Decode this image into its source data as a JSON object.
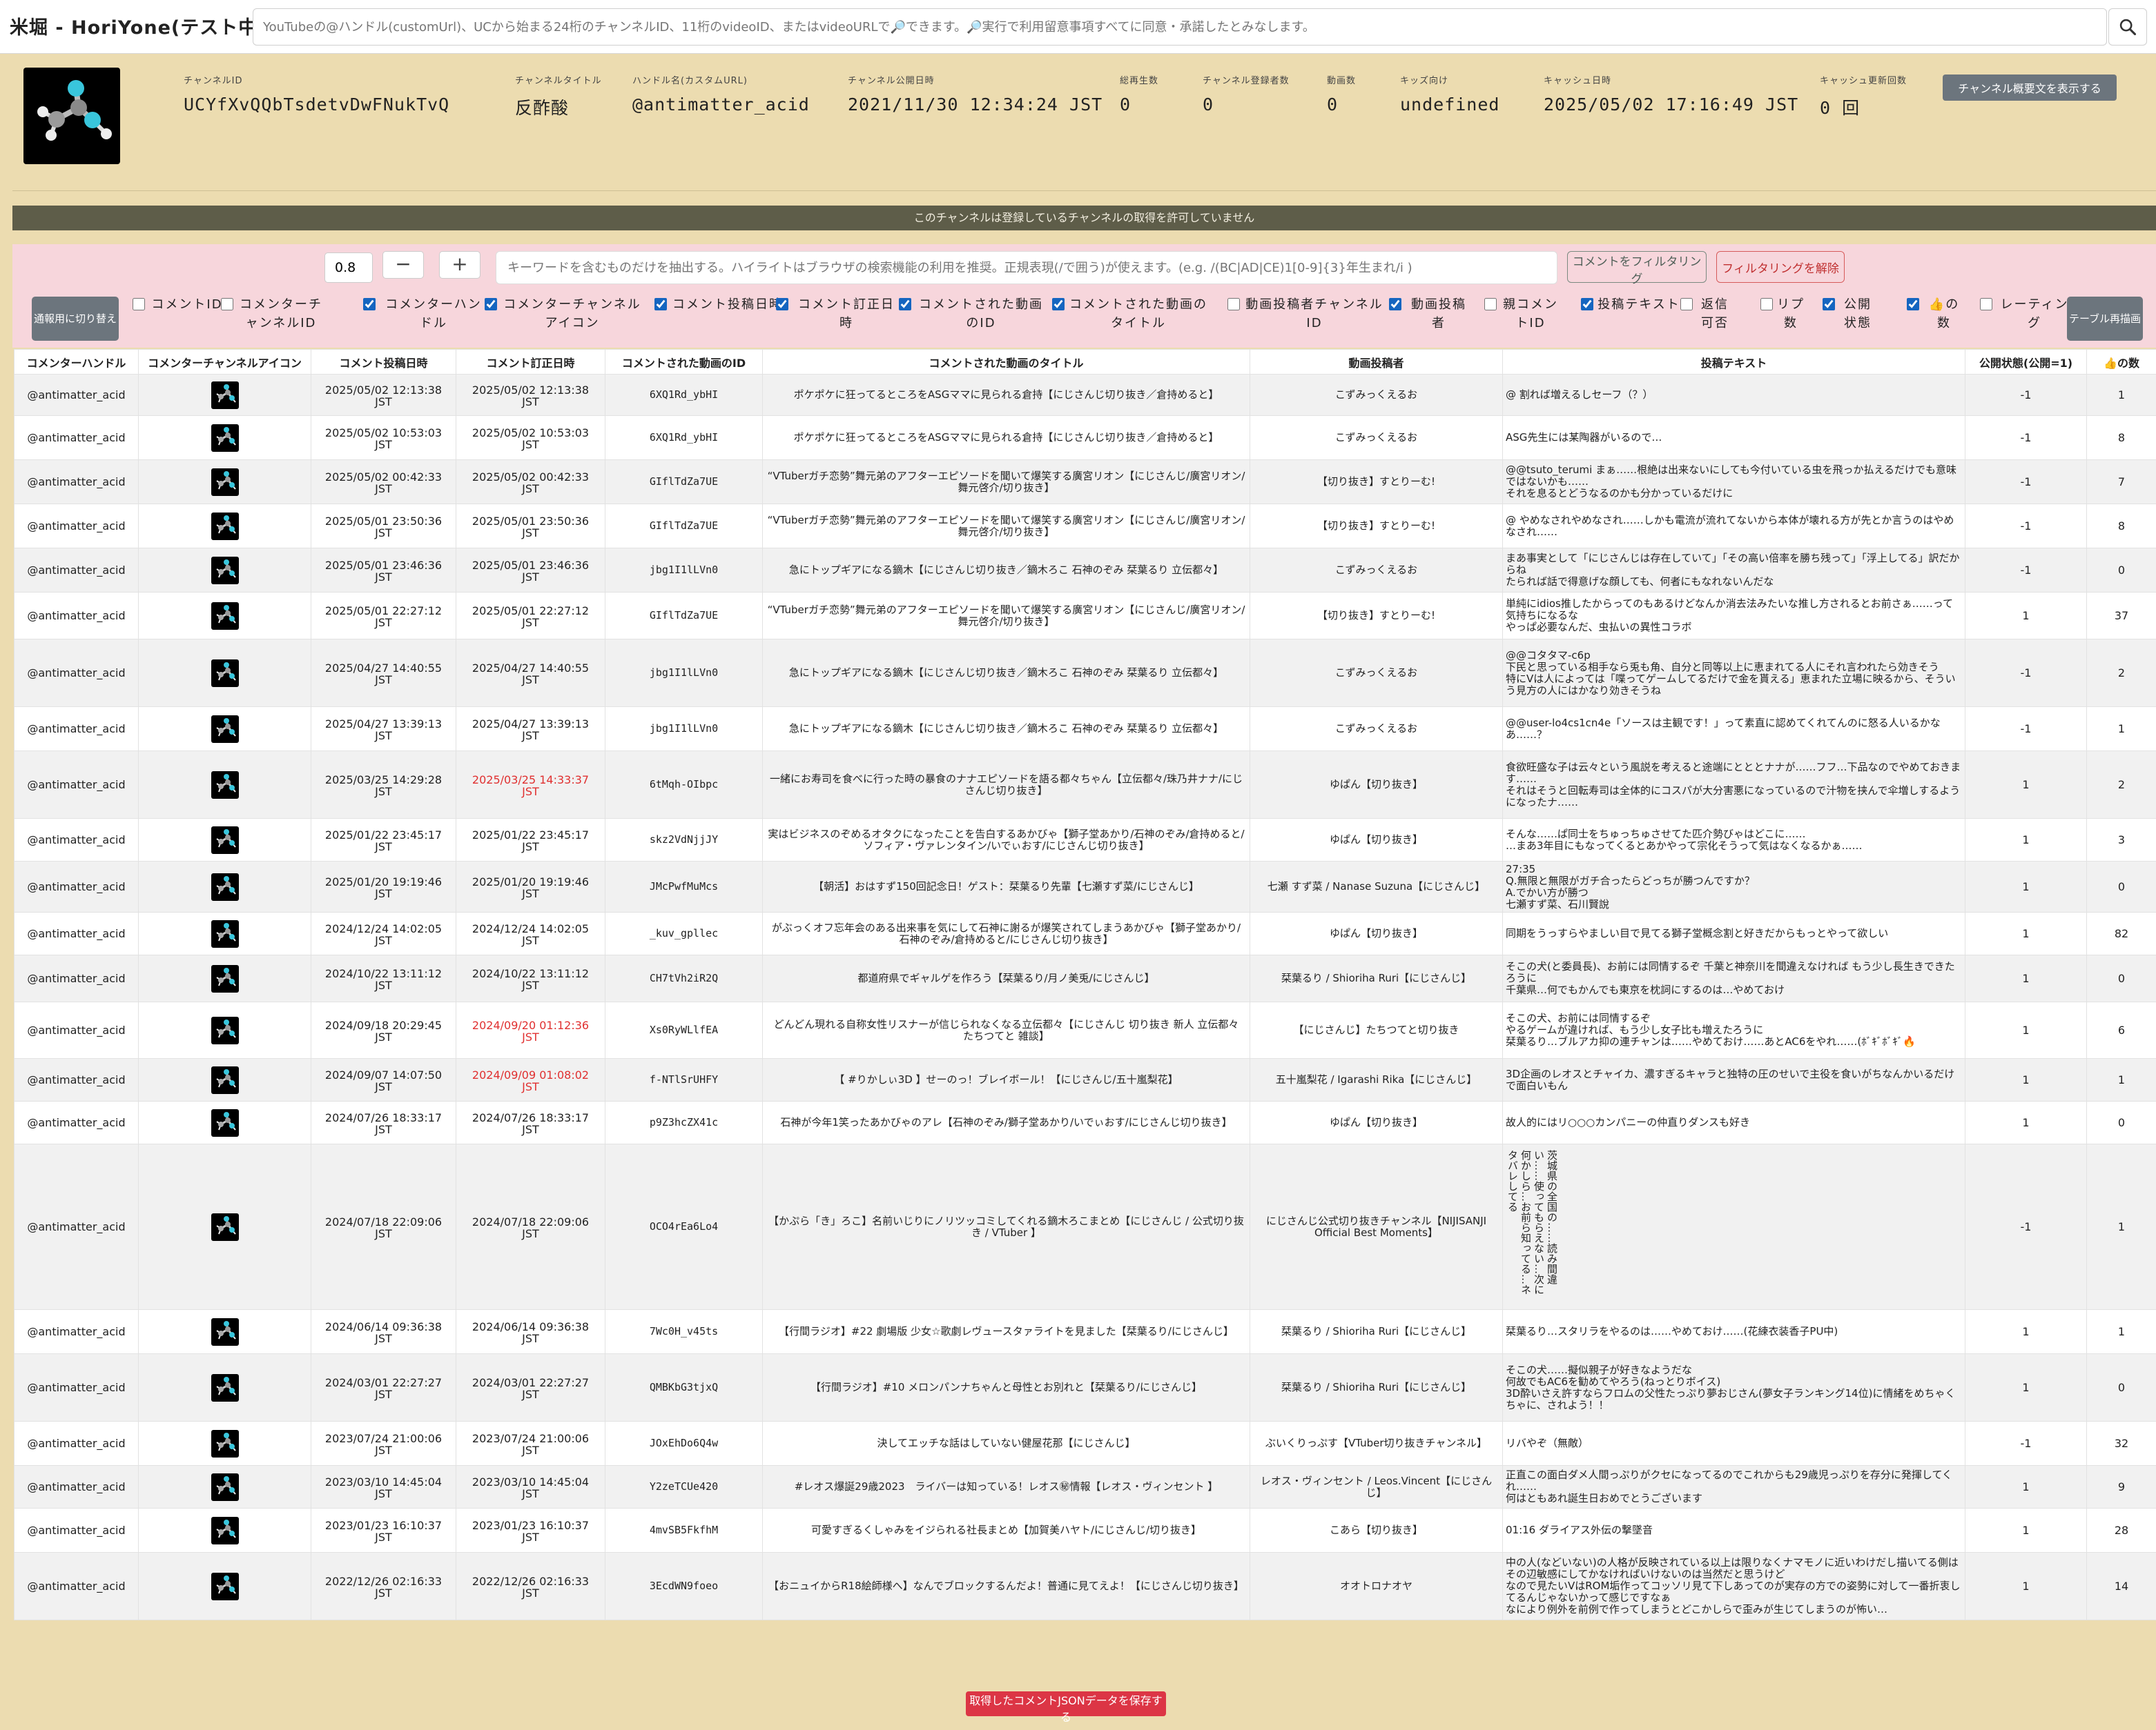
{
  "app_title": "米堀 - HoriYone(テスト中)",
  "search": {
    "placeholder": "YouTubeの@ハンドル(customUrl)、UCから始まる24桁のチャンネルID、11桁のvideoID、またはvideoURLで🔎できます。🔎実行で利用留意事項すべてに同意・承諾したとみなします。"
  },
  "channel": {
    "id_label": "チャンネルID",
    "id": "UCYfXvQQbTsdetvDwFNukTvQ",
    "title_label": "チャンネルタイトル",
    "title": "反酢酸",
    "handle_label": "ハンドル名(カスタムURL)",
    "handle": "@antimatter_acid",
    "published_label": "チャンネル公開日時",
    "published": "2021/11/30 12:34:24 JST",
    "views_label": "総再生数",
    "views": "0",
    "subs_label": "チャンネル登録者数",
    "subs": "0",
    "videos_label": "動画数",
    "videos": "0",
    "kids_label": "キッズ向け",
    "kids": "undefined",
    "cache_label": "キャッシュ日時",
    "cache": "2025/05/02 17:16:49 JST",
    "cache_count_label": "キャッシュ更新回数",
    "cache_count": "0 回",
    "summary_button": "チャンネル概要文を表示する"
  },
  "banner": "このチャンネルは登録しているチャンネルの取得を許可していません",
  "filter": {
    "threshold": "0.8",
    "minus": "−",
    "plus": "+",
    "keyword_placeholder": "キーワードを含むものだけを抽出する。ハイライトはブラウザの検索機能の利用を推奨。正規表現(/で囲う)が使えます。(e.g. /(BC|AD|CE)1[0-9]{3}年生まれ/i )",
    "apply_label": "コメントをフィルタリング",
    "clear_label": "フィルタリングを解除",
    "toggle_label": "通報用に切り替え",
    "redraw_label": "テーブル再描画"
  },
  "columns": [
    {
      "label": "コメントID",
      "checked": false
    },
    {
      "label": "コメンターチャンネルID",
      "checked": false
    },
    {
      "label": "コメンターハンドル",
      "checked": true
    },
    {
      "label": "コメンターチャンネルアイコン",
      "checked": true
    },
    {
      "label": "コメント投稿日時",
      "checked": true
    },
    {
      "label": "コメント訂正日時",
      "checked": true
    },
    {
      "label": "コメントされた動画のID",
      "checked": true
    },
    {
      "label": "コメントされた動画のタイトル",
      "checked": true
    },
    {
      "label": "動画投稿者チャンネルID",
      "checked": false
    },
    {
      "label": "動画投稿者",
      "checked": true
    },
    {
      "label": "親コメントID",
      "checked": false
    },
    {
      "label": "投稿テキスト",
      "checked": true
    },
    {
      "label": "返信可否",
      "checked": false
    },
    {
      "label": "リプ数",
      "checked": false
    },
    {
      "label": "公開状態",
      "checked": true
    },
    {
      "label": "👍の数",
      "checked": true
    },
    {
      "label": "レーティング",
      "checked": false
    }
  ],
  "table": {
    "headers": [
      "コメンターハンドル",
      "コメンターチャンネルアイコン",
      "コメント投稿日時",
      "コメント訂正日時",
      "コメントされた動画のID",
      "コメントされた動画のタイトル",
      "動画投稿者",
      "投稿テキスト",
      "公開状態(公開=1)",
      "👍の数"
    ],
    "rows": [
      {
        "handle": "@antimatter_acid",
        "posted": "2025/05/02 12:13:38\nJST",
        "edited": "2025/05/02 12:13:38\nJST",
        "edited_red": false,
        "video_id": "6XQ1Rd_ybHI",
        "title": "ポケポケに狂ってるところをASGママに見られる倉持【にじさんじ切り抜き／倉持めると】",
        "uploader": "こずみっくえるお",
        "text": "@ 割れば増えるしセーフ（？）",
        "status": "-1",
        "likes": "1"
      },
      {
        "handle": "@antimatter_acid",
        "posted": "2025/05/02 10:53:03\nJST",
        "edited": "2025/05/02 10:53:03\nJST",
        "edited_red": false,
        "video_id": "6XQ1Rd_ybHI",
        "title": "ポケポケに狂ってるところをASGママに見られる倉持【にじさんじ切り抜き／倉持めると】",
        "uploader": "こずみっくえるお",
        "text": "ASG先生には某陶器がいるので…",
        "status": "-1",
        "likes": "8"
      },
      {
        "handle": "@antimatter_acid",
        "posted": "2025/05/02 00:42:33\nJST",
        "edited": "2025/05/02 00:42:33\nJST",
        "edited_red": false,
        "video_id": "GIflTdZa7UE",
        "title": "“VTuberガチ恋勢”舞元弟のアフターエピソードを聞いて爆笑する廣宮リオン【にじさんじ/廣宮リオン/舞元啓介/切り抜き】",
        "uploader": "【切り抜き】すとりーむ!",
        "text": "@@tsuto_terumi まぁ……根絶は出来ないにしても今付いている虫を飛っか払えるだけでも意味ではないかも……\nそれを息るとどうなるのかも分かっているだけに",
        "status": "-1",
        "likes": "7"
      },
      {
        "handle": "@antimatter_acid",
        "posted": "2025/05/01 23:50:36\nJST",
        "edited": "2025/05/01 23:50:36\nJST",
        "edited_red": false,
        "video_id": "GIflTdZa7UE",
        "title": "“VTuberガチ恋勢”舞元弟のアフターエピソードを聞いて爆笑する廣宮リオン【にじさんじ/廣宮リオン/舞元啓介/切り抜き】",
        "uploader": "【切り抜き】すとりーむ!",
        "text": "@ やめなされやめなされ……しかも電流が流れてないから本体が壊れる方が先とか言うのはやめなされ……",
        "status": "-1",
        "likes": "8"
      },
      {
        "handle": "@antimatter_acid",
        "posted": "2025/05/01 23:46:36\nJST",
        "edited": "2025/05/01 23:46:36\nJST",
        "edited_red": false,
        "video_id": "jbg1I1lLVn0",
        "title": "急にトップギアになる鏑木【にじさんじ切り抜き／鏑木ろこ 石神のぞみ 栞葉るり 立伝都々】",
        "uploader": "こずみっくえるお",
        "text": "まあ事実として「にじさんじは存在していて」「その高い倍率を勝ち残って」「浮上してる」訳だからね\nたられば話で得意げな顔しても、何者にもなれないんだな",
        "status": "-1",
        "likes": "0"
      },
      {
        "handle": "@antimatter_acid",
        "posted": "2025/05/01 22:27:12\nJST",
        "edited": "2025/05/01 22:27:12\nJST",
        "edited_red": false,
        "video_id": "GIflTdZa7UE",
        "title": "“VTuberガチ恋勢”舞元弟のアフターエピソードを聞いて爆笑する廣宮リオン【にじさんじ/廣宮リオン/舞元啓介/切り抜き】",
        "uploader": "【切り抜き】すとりーむ!",
        "text": "単純にidios推したからってのもあるけどなんか消去法みたいな推し方されるとお前さぁ……って気持ちになるな\nやっぱ必要なんだ、虫払いの異性コラボ",
        "status": "1",
        "likes": "37"
      },
      {
        "handle": "@antimatter_acid",
        "posted": "2025/04/27 14:40:55\nJST",
        "edited": "2025/04/27 14:40:55\nJST",
        "edited_red": false,
        "video_id": "jbg1I1lLVn0",
        "title": "急にトップギアになる鏑木【にじさんじ切り抜き／鏑木ろこ 石神のぞみ 栞葉るり 立伝都々】",
        "uploader": "こずみっくえるお",
        "text": "@@コタタマ-c6p\n下民と思っている相手なら兎も角、自分と同等以上に恵まれてる人にそれ言われたら効きそう\n特にVは人によっては「喋ってゲームしてるだけで金を貰える」恵まれた立場に映るから、そういう見方の人にはかなり効きそうね",
        "status": "-1",
        "likes": "2"
      },
      {
        "handle": "@antimatter_acid",
        "posted": "2025/04/27 13:39:13\nJST",
        "edited": "2025/04/27 13:39:13\nJST",
        "edited_red": false,
        "video_id": "jbg1I1lLVn0",
        "title": "急にトップギアになる鏑木【にじさんじ切り抜き／鏑木ろこ 石神のぞみ 栞葉るり 立伝都々】",
        "uploader": "こずみっくえるお",
        "text": "@@user-lo4cs1cn4e「ソースは主観です！」って素直に認めてくれてんのに怒る人いるかなあ……？",
        "status": "-1",
        "likes": "1"
      },
      {
        "handle": "@antimatter_acid",
        "posted": "2025/03/25 14:29:28\nJST",
        "edited": "2025/03/25 14:33:37\nJST",
        "edited_red": true,
        "video_id": "6tMqh-OIbpc",
        "title": "一緒にお寿司を食べに行った時の暴食のナナエピソードを語る都々ちゃん【立伝都々/珠乃井ナナ/にじさんじ切り抜き】",
        "uploader": "ゆぱん【切り抜き】",
        "text": "食欲旺盛な子は云々という風説を考えると途端にとととナナが……フフ…下品なのでやめておきます……\nそれはそうと回転寿司は全体的にコスパが大分害悪になっているので汁物を挟んで伞増しするようになったナ……",
        "status": "1",
        "likes": "2"
      },
      {
        "handle": "@antimatter_acid",
        "posted": "2025/01/22 23:45:17\nJST",
        "edited": "2025/01/22 23:45:17\nJST",
        "edited_red": false,
        "video_id": "skz2VdNjjJY",
        "title": "実はビジネスのぞめるオタクになったことを告白するあかびゃ【獅子堂あかり/石神のぞみ/倉持めると/ソフィア・ヴァレンタイン/いでぃおす/にじさんじ切り抜き】",
        "uploader": "ゆぱん【切り抜き】",
        "text": "そんな……ぱ同士をちゅっちゅさせてた匹介勢びゃはどこに……\n…まあ3年目にもなってくるとあかやって宗化そうって気はなくなるかぁ……",
        "status": "1",
        "likes": "3"
      },
      {
        "handle": "@antimatter_acid",
        "posted": "2025/01/20 19:19:46\nJST",
        "edited": "2025/01/20 19:19:46\nJST",
        "edited_red": false,
        "video_id": "JMcPwfMuMcs",
        "title": "【朝活】おはすず150回記念日！ゲスト：栞葉るり先輩【七瀬すず菜/にじさんじ】",
        "uploader": "七瀬 すず菜 / Nanase Suzuna【にじさんじ】",
        "text": "27:35\nQ.無限と無限がガチ合ったらどっちが勝つんですか？\nA.でかい方が勝つ\n七瀬すず菜、石川賢說",
        "status": "1",
        "likes": "0"
      },
      {
        "handle": "@antimatter_acid",
        "posted": "2024/12/24 14:02:05\nJST",
        "edited": "2024/12/24 14:02:05\nJST",
        "edited_red": false,
        "video_id": "_kuv_gpllec",
        "title": "がぶっくオフ忘年会のある出来事を気にして石神に謝るが爆笑されてしまうあかびゃ【獅子堂あかり/石神のぞみ/倉持めると/にじさんじ切り抜き】",
        "uploader": "ゆぱん【切り抜き】",
        "text": "同期をうっすらやましい目で見てる獅子堂概念割と好きだからもっとやって欲しい",
        "status": "1",
        "likes": "82"
      },
      {
        "handle": "@antimatter_acid",
        "posted": "2024/10/22 13:11:12\nJST",
        "edited": "2024/10/22 13:11:12\nJST",
        "edited_red": false,
        "video_id": "CH7tVh2iR2Q",
        "title": "都道府県でギャルゲを作ろう【栞葉るり/月ノ美兎/にじさんじ】",
        "uploader": "栞葉るり / Shioriha Ruri【にじさんじ】",
        "text": "そこの犬(と委員長)、お前には同情するぞ 千葉と神奈川を間違えなければ もう少し長生きできたろうに\n千葉県…何でもかんでも東京を枕詞にするのは…やめておけ",
        "status": "1",
        "likes": "0"
      },
      {
        "handle": "@antimatter_acid",
        "posted": "2024/09/18 20:29:45\nJST",
        "edited": "2024/09/20 01:12:36\nJST",
        "edited_red": true,
        "video_id": "Xs0RyWLlfEA",
        "title": "どんどん現れる自称女性リスナーが信じられなくなる立伝都々【にじさんじ 切り抜き 新人 立伝都々 たちつてと 雑談】",
        "uploader": "【にじさんじ】たちつてと切り抜き",
        "text": "そこの犬、お前には同情するぞ\nやるゲームが違ければ、もう少し女子比も増えたろうに\n栞葉るり…ブルアカ抑の連チャンは……やめておけ……あとAC6をやれ……(ﾎﾞｷﾞﾎﾞｷﾞ🔥",
        "status": "1",
        "likes": "6"
      },
      {
        "handle": "@antimatter_acid",
        "posted": "2024/09/07 14:07:50\nJST",
        "edited": "2024/09/09 01:08:02\nJST",
        "edited_red": true,
        "video_id": "f-NTlSrUHFY",
        "title": "【 #りかしぃ3D 】せーのっ！ブレイボール！【にじさんじ/五十嵐梨花】",
        "uploader": "五十嵐梨花 / Igarashi Rika【にじさんじ】",
        "text": "3D企画のレオスとチャイカ、濃すぎるキャラと独特の圧のせいで主役を食いがちなんかいるだけで面白いもん",
        "status": "1",
        "likes": "1"
      },
      {
        "handle": "@antimatter_acid",
        "posted": "2024/07/26 18:33:17\nJST",
        "edited": "2024/07/26 18:33:17\nJST",
        "edited_red": false,
        "video_id": "p9Z3hcZX41c",
        "title": "石神が今年1笑ったあかびゃのアレ【石神のぞみ/獅子堂あかり/いでぃおす/にじさんじ切り抜き】",
        "uploader": "ゆぱん【切り抜き】",
        "text": "故人的にはリ○○○カンパニーの仲直りダンスも好き",
        "status": "1",
        "likes": "0"
      },
      {
        "handle": "@antimatter_acid",
        "posted": "2024/07/18 22:09:06\nJST",
        "edited": "2024/07/18 22:09:06\nJST",
        "edited_red": false,
        "video_id": "OCO4rEa6Lo4",
        "title": "【かぷら「き」ろこ】名前いじりにノリツッコミしてくれる鏑木ろこまとめ【にじさんじ / 公式切り抜き / VTuber 】",
        "uploader": "にじさんじ公式切り抜きチャンネル【NIJISANJI Official Best Moments】",
        "text": "茨城県の全国の……読み間違い……使ってもらえない…次に何かしら…お前ら知ってる…ネタバレしてる",
        "status": "-1",
        "likes": "1"
      },
      {
        "handle": "@antimatter_acid",
        "posted": "2024/06/14 09:36:38\nJST",
        "edited": "2024/06/14 09:36:38\nJST",
        "edited_red": false,
        "video_id": "7Wc0H_v45ts",
        "title": "【行間ラジオ】#22 劇場版 少女☆歌劇レヴュースタァライトを見ました【栞葉るり/にじさんじ】",
        "uploader": "栞葉るり / Shioriha Ruri【にじさんじ】",
        "text": "栞葉るり…スタリラをやるのは……やめておけ……(花練衣装香子PU中)",
        "status": "1",
        "likes": "1"
      },
      {
        "handle": "@antimatter_acid",
        "posted": "2024/03/01 22:27:27\nJST",
        "edited": "2024/03/01 22:27:27\nJST",
        "edited_red": false,
        "video_id": "QMBKbG3tjxQ",
        "title": "【行間ラジオ】#10 メロンパンナちゃんと母性とお別れと【栞葉るり/にじさんじ】",
        "uploader": "栞葉るり / Shioriha Ruri【にじさんじ】",
        "text": "そこの犬……擬似親子が好きなようだな\n何故でもAC6を勧めてやろう(ねっとりボイス)\n3D酔いさえ許すならフロムの父性たっぷり夢おじさん(夢女子ランキング14位)に情緒をめちゃくちゃに、されよう！！",
        "status": "1",
        "likes": "0"
      },
      {
        "handle": "@antimatter_acid",
        "posted": "2023/07/24 21:00:06\nJST",
        "edited": "2023/07/24 21:00:06\nJST",
        "edited_red": false,
        "video_id": "JOxEhDo6Q4w",
        "title": "決してエッチな話はしていない健屋花那【にじさんじ】",
        "uploader": "ぶいくりっぷす【VTuber切り抜きチャンネル】",
        "text": "リバやぞ（無敵）",
        "status": "-1",
        "likes": "32"
      },
      {
        "handle": "@antimatter_acid",
        "posted": "2023/03/10 14:45:04\nJST",
        "edited": "2023/03/10 14:45:04\nJST",
        "edited_red": false,
        "video_id": "Y2zeTCUe420",
        "title": "#レオス爆誕29歳2023　ライバーは知っている！レオス㊙情報【レオス・ヴィンセント 】",
        "uploader": "レオス・ヴィンセント / Leos.Vincent【にじさんじ】",
        "text": "正直この面白ダメ人間っぷりがクセになってるのでこれからも29歳児っぷりを存分に発揮してくれ……\n何はともあれ誕生日おめでとうございます",
        "status": "1",
        "likes": "9"
      },
      {
        "handle": "@antimatter_acid",
        "posted": "2023/01/23 16:10:37\nJST",
        "edited": "2023/01/23 16:10:37\nJST",
        "edited_red": false,
        "video_id": "4mvSB5FkfhM",
        "title": "可愛すぎるくしゃみをイジられる社長まとめ【加賀美ハヤト/にじさんじ/切り抜き】",
        "uploader": "こあら【切り抜き】",
        "text": "01:16 ダライアス外伝の撃墜音",
        "status": "1",
        "likes": "28"
      },
      {
        "handle": "@antimatter_acid",
        "posted": "2022/12/26 02:16:33\nJST",
        "edited": "2022/12/26 02:16:33\nJST",
        "edited_red": false,
        "video_id": "3EcdWN9foeo",
        "title": "【おニュイからR18絵師様へ】なんでブロックするんだよ！普通に見てえよ！【にじさんじ切り抜き】",
        "uploader": "オオトロナオヤ",
        "text": "中の人(などいない)の人格が反映されている以上は限りなくナマモノに近いわけだし描いてる側はその辺敏感にしてかなければいけないのは当然だと思うけど\nなので見たいVはROM垢作ってコッソリ見て下しあってのが実存の方での姿勢に対して一番折衷してるんじゃないかって感じですなぁ\nなにより例外を前例で作ってしまうとどこかしらで歪みが生じてしまうのが怖い…",
        "status": "1",
        "likes": "14"
      }
    ]
  },
  "save_button": "取得したコメントJSONデータを保存する"
}
